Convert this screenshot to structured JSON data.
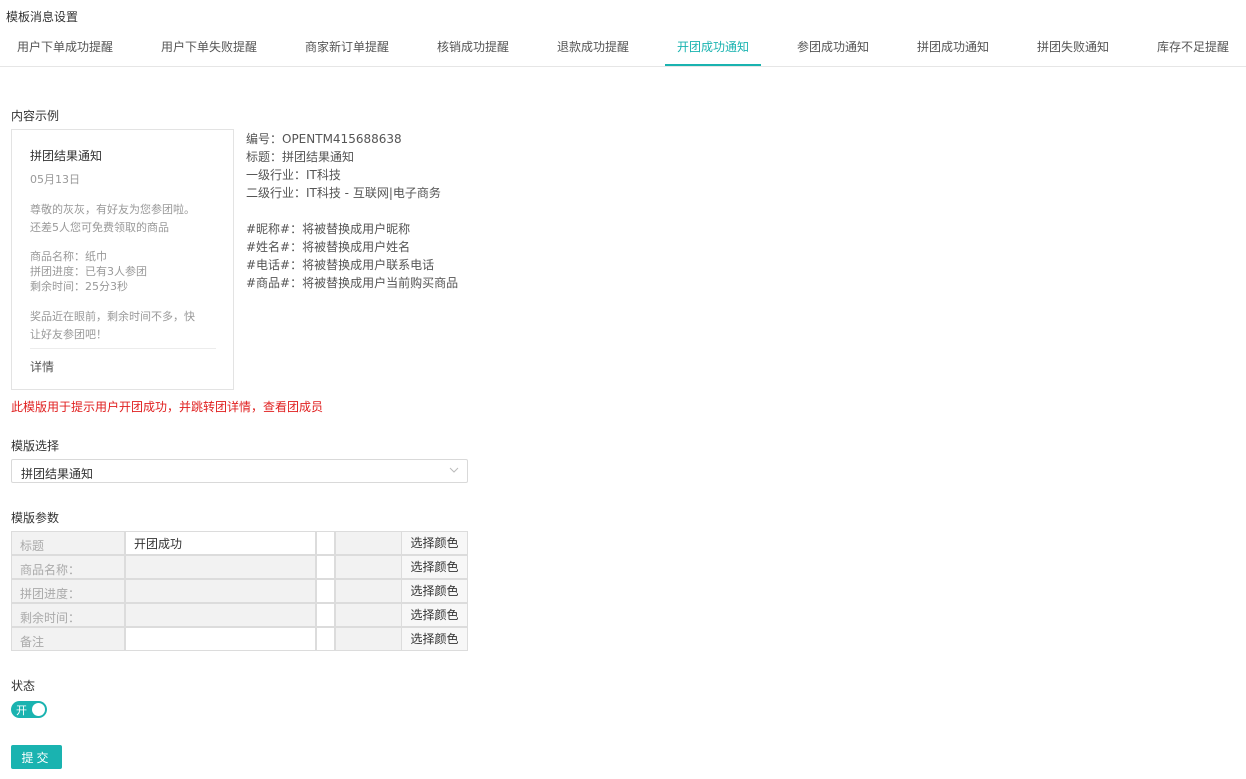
{
  "page_title": "模板消息设置",
  "tabs": [
    {
      "label": "用户下单成功提醒",
      "active": false
    },
    {
      "label": "用户下单失败提醒",
      "active": false
    },
    {
      "label": "商家新订单提醒",
      "active": false
    },
    {
      "label": "核销成功提醒",
      "active": false
    },
    {
      "label": "退款成功提醒",
      "active": false
    },
    {
      "label": "开团成功通知",
      "active": true
    },
    {
      "label": "参团成功通知",
      "active": false
    },
    {
      "label": "拼团成功通知",
      "active": false
    },
    {
      "label": "拼团失败通知",
      "active": false
    },
    {
      "label": "库存不足提醒",
      "active": false
    }
  ],
  "content_example": {
    "label": "内容示例",
    "card": {
      "title": "拼团结果通知",
      "date": "05月13日",
      "lines": [
        "尊敬的灰灰，有好友为您参团啦。",
        "还差5人您可免费领取的商品",
        "商品名称：纸巾",
        "拼团进度：已有3人参团",
        "剩余时间：25分3秒",
        "奖品近在眼前，剩余时间不多，快",
        "让好友参团吧！"
      ],
      "detail": "详情"
    },
    "info": [
      "编号：OPENTM415688638",
      "标题：拼团结果通知",
      "一级行业：IT科技",
      "二级行业：IT科技 - 互联网|电子商务",
      "#昵称#：将被替换成用户昵称",
      "#姓名#：将被替换成用户姓名",
      "#电话#：将被替换成用户联系电话",
      "#商品#：将被替换成用户当前购买商品"
    ]
  },
  "warning": "此模版用于提示用户开团成功，并跳转团详情，查看团成员",
  "template_select": {
    "label": "模版选择",
    "value": "拼团结果通知"
  },
  "template_params": {
    "label": "模版参数",
    "color_button_label": "选择颜色",
    "rows": [
      {
        "label": "标题",
        "value": "开团成功",
        "editable": true
      },
      {
        "label": "商品名称：",
        "value": "",
        "editable": false
      },
      {
        "label": "拼团进度：",
        "value": "",
        "editable": false
      },
      {
        "label": "剩余时间：",
        "value": "",
        "editable": false
      },
      {
        "label": "备注",
        "value": "",
        "editable": true
      }
    ]
  },
  "status": {
    "label": "状态",
    "toggle_text": "开",
    "on": true
  },
  "submit_label": "提交",
  "colors": {
    "accent": "#1ab3b0",
    "warning": "#e02020"
  }
}
